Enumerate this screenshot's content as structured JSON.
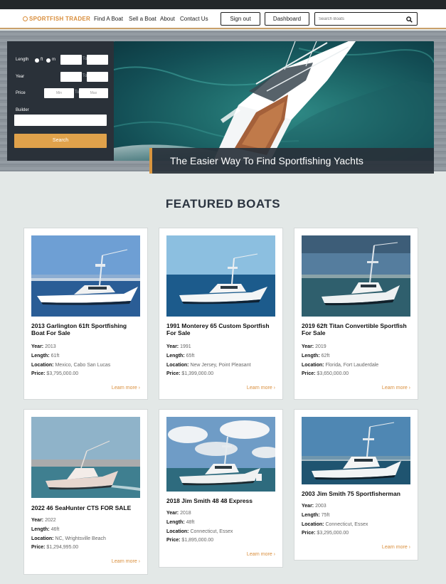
{
  "nav": {
    "logo": "SPORTFISH TRADER",
    "links": [
      "Find A Boat",
      "Sell a Boat",
      "About",
      "Contact Us"
    ],
    "sign_out": "Sign out",
    "dashboard": "Dashboard",
    "search_placeholder": "Search Boats"
  },
  "filter": {
    "length_label": "Length",
    "unit_ft": "ft",
    "unit_m": "m",
    "year_label": "Year",
    "price_label": "Price",
    "to": "To",
    "min_placeholder": "Min",
    "max_placeholder": "Max",
    "builder_label": "Builder",
    "search_button": "Search"
  },
  "hero": {
    "tagline": "The Easier Way To Find Sportfishing Yachts"
  },
  "featured": {
    "heading": "FEATURED BOATS",
    "field_labels": {
      "year": "Year:",
      "length": "Length:",
      "location": "Location:",
      "price": "Price:"
    },
    "learn_more": "Learn more ›",
    "boats": [
      {
        "title": "2013 Garlington 61ft Sportfishing Boat For Sale",
        "year": "2013",
        "length": "61ft",
        "location": "Mexico, Cabo San Lucas",
        "price": "$3,795,000.00"
      },
      {
        "title": "1991 Monterey 65 Custom Sportfish For Sale",
        "year": "1991",
        "length": "65ft",
        "location": "New Jersey, Point Pleasant",
        "price": "$1,399,000.00"
      },
      {
        "title": "2019 62ft Titan Convertible Sportfish For Sale",
        "year": "2019",
        "length": "62ft",
        "location": "Florida, Fort Lauderdale",
        "price": "$3,650,000.00"
      },
      {
        "title": "2022 46 SeaHunter CTS FOR SALE",
        "year": "2022",
        "length": "46ft",
        "location": "NC, Wrightsville Beach",
        "price": "$1,294,995.00"
      },
      {
        "title": "2018 Jim Smith 48 48 Express",
        "year": "2018",
        "length": "48ft",
        "location": "Connecticut, Essex",
        "price": "$1,895,000.00"
      },
      {
        "title": "2003 Jim Smith 75 Sportfisherman",
        "year": "2003",
        "length": "75ft",
        "location": "Connecticut, Essex",
        "price": "$3,295,000.00"
      }
    ]
  }
}
